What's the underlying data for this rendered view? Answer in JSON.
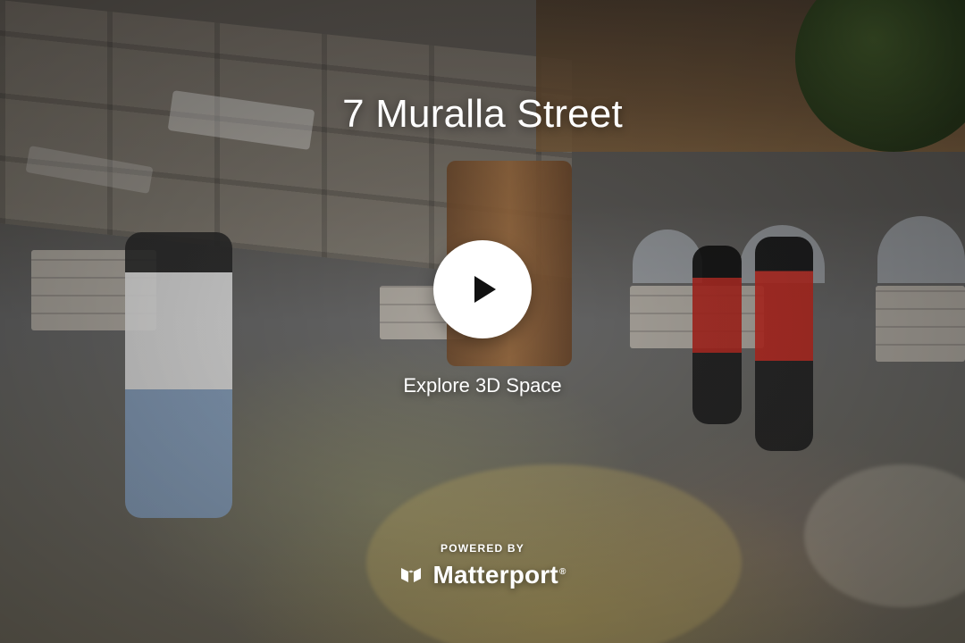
{
  "viewer": {
    "title": "7 Muralla Street",
    "explore_label": "Explore 3D Space",
    "powered_by": "POWERED BY",
    "brand_name": "Matterport",
    "brand_registered_mark": "®",
    "play_icon": "play-icon",
    "brand_icon": "matterport-logo-icon"
  },
  "colors": {
    "overlay_text": "#ffffff",
    "play_button_bg": "#ffffff",
    "play_icon": "#111111"
  }
}
